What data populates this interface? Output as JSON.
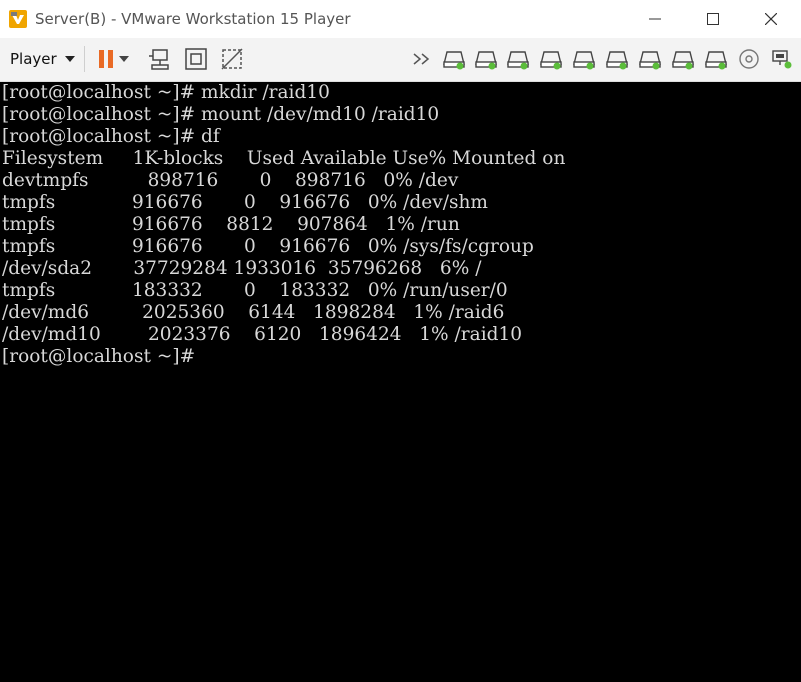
{
  "window": {
    "title": "Server(B) - VMware Workstation 15 Player"
  },
  "toolbar": {
    "player_label": "Player",
    "device_count": 7
  },
  "colors": {
    "pause": "#e96a25",
    "device_green": "#5bbd3a",
    "terminal_bg": "#000000",
    "terminal_fg": "#d8d8d8"
  },
  "terminal": {
    "lines": [
      "[root@localhost ~]# mkdir /raid10",
      "[root@localhost ~]# mount /dev/md10 /raid10",
      "[root@localhost ~]# df",
      "Filesystem     1K-blocks    Used Available Use% Mounted on",
      "devtmpfs          898716       0    898716   0% /dev",
      "tmpfs             916676       0    916676   0% /dev/shm",
      "tmpfs             916676    8812    907864   1% /run",
      "tmpfs             916676       0    916676   0% /sys/fs/cgroup",
      "/dev/sda2       37729284 1933016  35796268   6% /",
      "tmpfs             183332       0    183332   0% /run/user/0",
      "/dev/md6         2025360    6144   1898284   1% /raid6",
      "/dev/md10        2023376    6120   1896424   1% /raid10",
      "[root@localhost ~]#"
    ]
  }
}
